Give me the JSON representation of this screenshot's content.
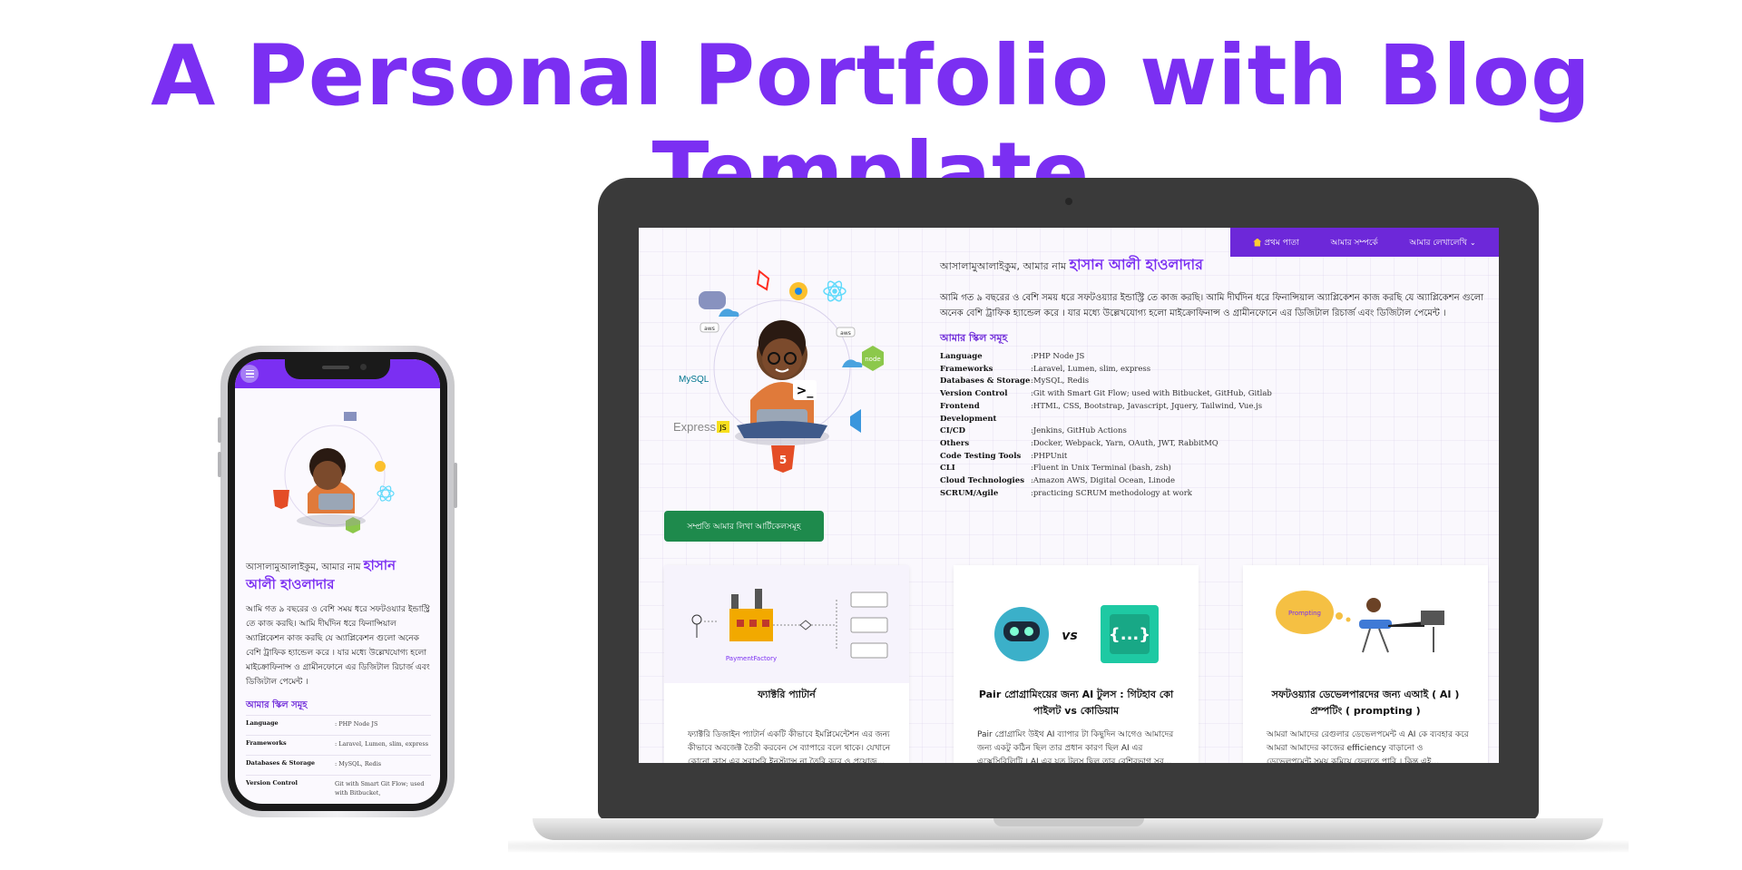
{
  "banner": {
    "title": "A Personal Portfolio with Blog Template"
  },
  "nav": [
    {
      "label": "প্রথম পাতা",
      "icon": "home-icon"
    },
    {
      "label": "আমার সম্পর্কে"
    },
    {
      "label": "আমার লেখালেখি",
      "icon": "chevron-down-icon"
    }
  ],
  "intro": {
    "greeting": "আসালামুআলাইকুম, আমার নাম ",
    "name": "হাসান আলী হাওলাদার",
    "about": "আমি গত ৯ বছরের ও বেশি সময় ধরে সফটওয়্যার ইন্ডাস্ট্রি তে কাজ করছি। আমি দীর্ঘদিন ধরে ফিনান্সিয়াল অ্যাপ্লিকেশন কাজ করছি যে অ্যাপ্লিকেশন গুলো অনেক বেশি ট্রাফিক হ্যান্ডেল করে । যার মধ্যে উল্লেখযোগ্য হলো মাইক্রোফিনান্স ও গ্রামীনফোনে এর ডিজিটাল রিচার্জ এবং ডিজিটাল পেমেন্ট ।",
    "about_mobile": "আমি গত ৯ বছরের ও বেশি সময় ধরে সফটওয়্যার ইন্ডাস্ট্রি তে কাজ করছি। আমি দীর্ঘদিন ধরে ফিনান্সিয়াল অ্যাপ্লিকেশন কাজ করছি যে অ্যাপ্লিকেশন গুলো অনেক বেশি ট্রাফিক হ্যান্ডেল করে । যার মধ্যে উল্লেখযোগ্য হলো মাইক্রোফিনান্স ও গ্রামীনফোনে এর ডিজিটাল রিচার্জ এবং ডিজিটাল পেমেন্ট ।",
    "skills_heading": "আমার স্কিল সমূহ"
  },
  "skills": [
    {
      "key": "Language",
      "value": ":PHP Node JS"
    },
    {
      "key": "Frameworks",
      "value": ":Laravel, Lumen, slim, express"
    },
    {
      "key": "Databases & Storage",
      "value": ":MySQL, Redis"
    },
    {
      "key": "Version Control",
      "value": ":Git with Smart Git Flow; used with Bitbucket, GitHub, Gitlab"
    },
    {
      "key": "Frontend Development",
      "value": ":HTML, CSS, Bootstrap, Javascript, Jquery, Tailwind, Vue.js"
    },
    {
      "key": "CI/CD",
      "value": ":Jenkins, GitHub Actions"
    },
    {
      "key": "Others",
      "value": ":Docker, Webpack, Yarn, OAuth, JWT, RabbitMQ"
    },
    {
      "key": "Code Testing Tools",
      "value": ":PHPUnit"
    },
    {
      "key": "CLI",
      "value": ":Fluent in Unix Terminal (bash, zsh)"
    },
    {
      "key": "Cloud Technologies",
      "value": ":Amazon AWS, Digital Ocean, Linode"
    },
    {
      "key": "SCRUM/Agile",
      "value": ":practicing SCRUM methodology at work"
    }
  ],
  "phone_skills": [
    {
      "key": "Language",
      "value": ": PHP Node JS"
    },
    {
      "key": "Frameworks",
      "value": ": Laravel, Lumen, slim, express"
    },
    {
      "key": "Databases & Storage",
      "value": ": MySQL, Redis"
    },
    {
      "key": "Version Control",
      "value": "Git with Smart Git Flow; used with Bitbucket,"
    }
  ],
  "recent_button": "সম্প্রতি আমার লিখা আর্টিকেলসমূহ",
  "cards": [
    {
      "title": "ফ্যাক্টরি প্যাটার্ন",
      "excerpt": "ফ্যাক্টরি ডিজাইন প্যাটার্ন একটি কীভাবে ইমপ্লিমেন্টেশন এর জন্য কীভাবে অবজেক্ট তৈরী করবেন সে ব্যাপারে বলে থাকে। যেখানে কোনো ক্লাস এর সরাসরি ইনস্ট্যান্স না তৈরি করে ও প্রয়োজ...",
      "illus_label": "PaymentFactory"
    },
    {
      "title": "Pair প্রোগ্রামিংয়ের জন্য AI টুলস : গিটহাব কো পাইলট vs কোডিয়াম",
      "excerpt": "Pair প্রোগ্রামিং উইথ AI ব্যাপার টা কিছুদিন আগেও আমাদের জন্য একটু কঠিন ছিল তার প্রধান কারণ ছিল AI এর এক্সেসিবিলিটি । AI এর যত টুলস ছিল তার বেশিরভাগ সব..."
    },
    {
      "title": "সফটওয়্যার ডেভেলপারদের জন্য এআই ( AI ) প্রম্পটিং ( prompting )",
      "excerpt": "আমরা আমাদের রেগুলার ডেভেলপমেন্ট এ AI কে ব্যবহার করে আমরা আমাদের কাজের efficiency বাড়ানো ও ডেভেলপমেন্ট সময় কমিয়ে ফেলতে পারি । কিন্তু এই...",
      "illus_label": "Prompting"
    }
  ],
  "logos": {
    "mysql": "MySQL",
    "express": "Express",
    "express_js": "JS",
    "node": "node",
    "aws": "aws",
    "html5": "5",
    "terminal": ">_"
  },
  "colors": {
    "brand_purple": "#7b2ff2",
    "nav_purple": "#6d28d9",
    "button_green": "#1e8a4c",
    "laptop_bezel": "#3a3a3a"
  }
}
